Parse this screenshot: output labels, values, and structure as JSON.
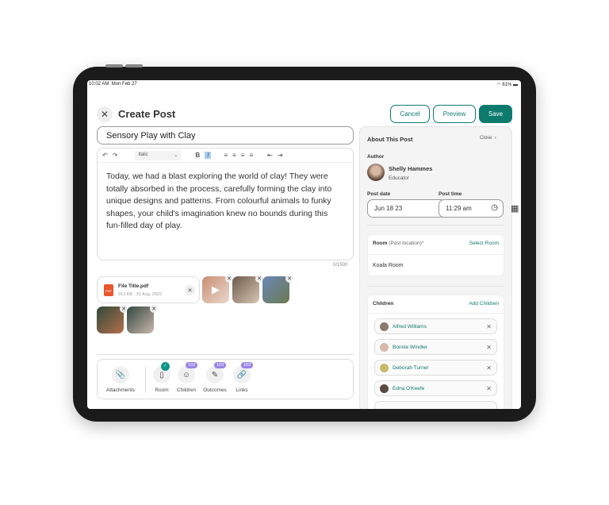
{
  "status": {
    "time": "10:02 AM",
    "date": "Mon Feb 27",
    "battery": "61%"
  },
  "header": {
    "title": "Create Post",
    "cancel": "Cancel",
    "preview": "Preview",
    "save": "Save"
  },
  "post": {
    "title": "Sensory Play with Clay",
    "body": "Today, we had a blast exploring the world of clay! They were totally absorbed in the process, carefully forming the clay into unique designs and patterns. From colourful animals to funky shapes, your child's imagination knew no bounds during this fun-filled day of play.",
    "counter": "0/1500",
    "style_select": "Italic"
  },
  "file": {
    "name": "File Title.pdf",
    "meta": "313 KB . 31 Aug, 2022",
    "icon_label": "PDF"
  },
  "tools": [
    {
      "label": "Attachments"
    },
    {
      "label": "Room"
    },
    {
      "label": "Children",
      "badge": "103"
    },
    {
      "label": "Outcomes",
      "badge": "103"
    },
    {
      "label": "Links",
      "badge": "103"
    }
  ],
  "panel": {
    "title": "About This Post",
    "close": "Close",
    "author_label": "Author",
    "author_name": "Shelly Hammes",
    "author_role": "Educator",
    "date_label": "Post date",
    "date": "Jun 18 23",
    "time_label": "Post time",
    "time": "11:29 am",
    "room": {
      "label": "Room",
      "sub": "(Post location)*",
      "action": "Select Room",
      "value": "Koala Room"
    },
    "children": {
      "label": "Children",
      "action": "Add Children",
      "items": [
        "Alfred Williams",
        "Bonnie Windler",
        "Deborah Turner",
        "Edna O'Keefe"
      ]
    }
  },
  "colors": {
    "accent": "#0d7a6e",
    "badge": "#9a84e8"
  }
}
